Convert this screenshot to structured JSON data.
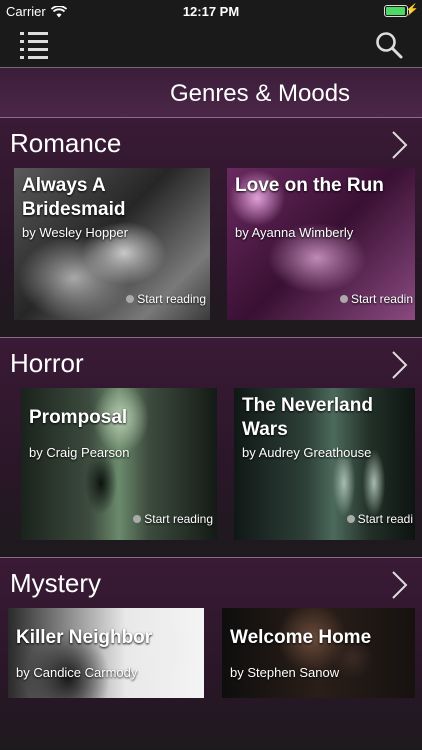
{
  "status_bar": {
    "carrier": "Carrier",
    "time": "12:17 PM",
    "battery_level": 0.95,
    "battery_color": "#4cd964"
  },
  "nav": {
    "menu_icon": "list-icon",
    "search_icon": "search-icon"
  },
  "page_title": "Genres & Moods",
  "colors": {
    "accent": "#4c2648",
    "divider": "#8a6c88",
    "background": "#1e1e1e"
  },
  "sections": [
    {
      "title": "Romance",
      "cards": [
        {
          "title": "Always A Bridesmaid",
          "author": "by Wesley Hopper",
          "action": "Start reading"
        },
        {
          "title": "Love on the Run",
          "author": "by Ayanna Wimberly",
          "action": "Start readin"
        }
      ]
    },
    {
      "title": "Horror",
      "cards": [
        {
          "title": "Promposal",
          "author": "by Craig Pearson",
          "action": "Start reading"
        },
        {
          "title": "The Neverland Wars",
          "author": "by Audrey Greathouse",
          "action": "Start readi"
        }
      ]
    },
    {
      "title": "Mystery",
      "cards": [
        {
          "title": "Killer Neighbor",
          "author": "by Candice Carmody",
          "action": ""
        },
        {
          "title": "Welcome Home",
          "author": "by Stephen Sanow",
          "action": ""
        }
      ]
    }
  ]
}
